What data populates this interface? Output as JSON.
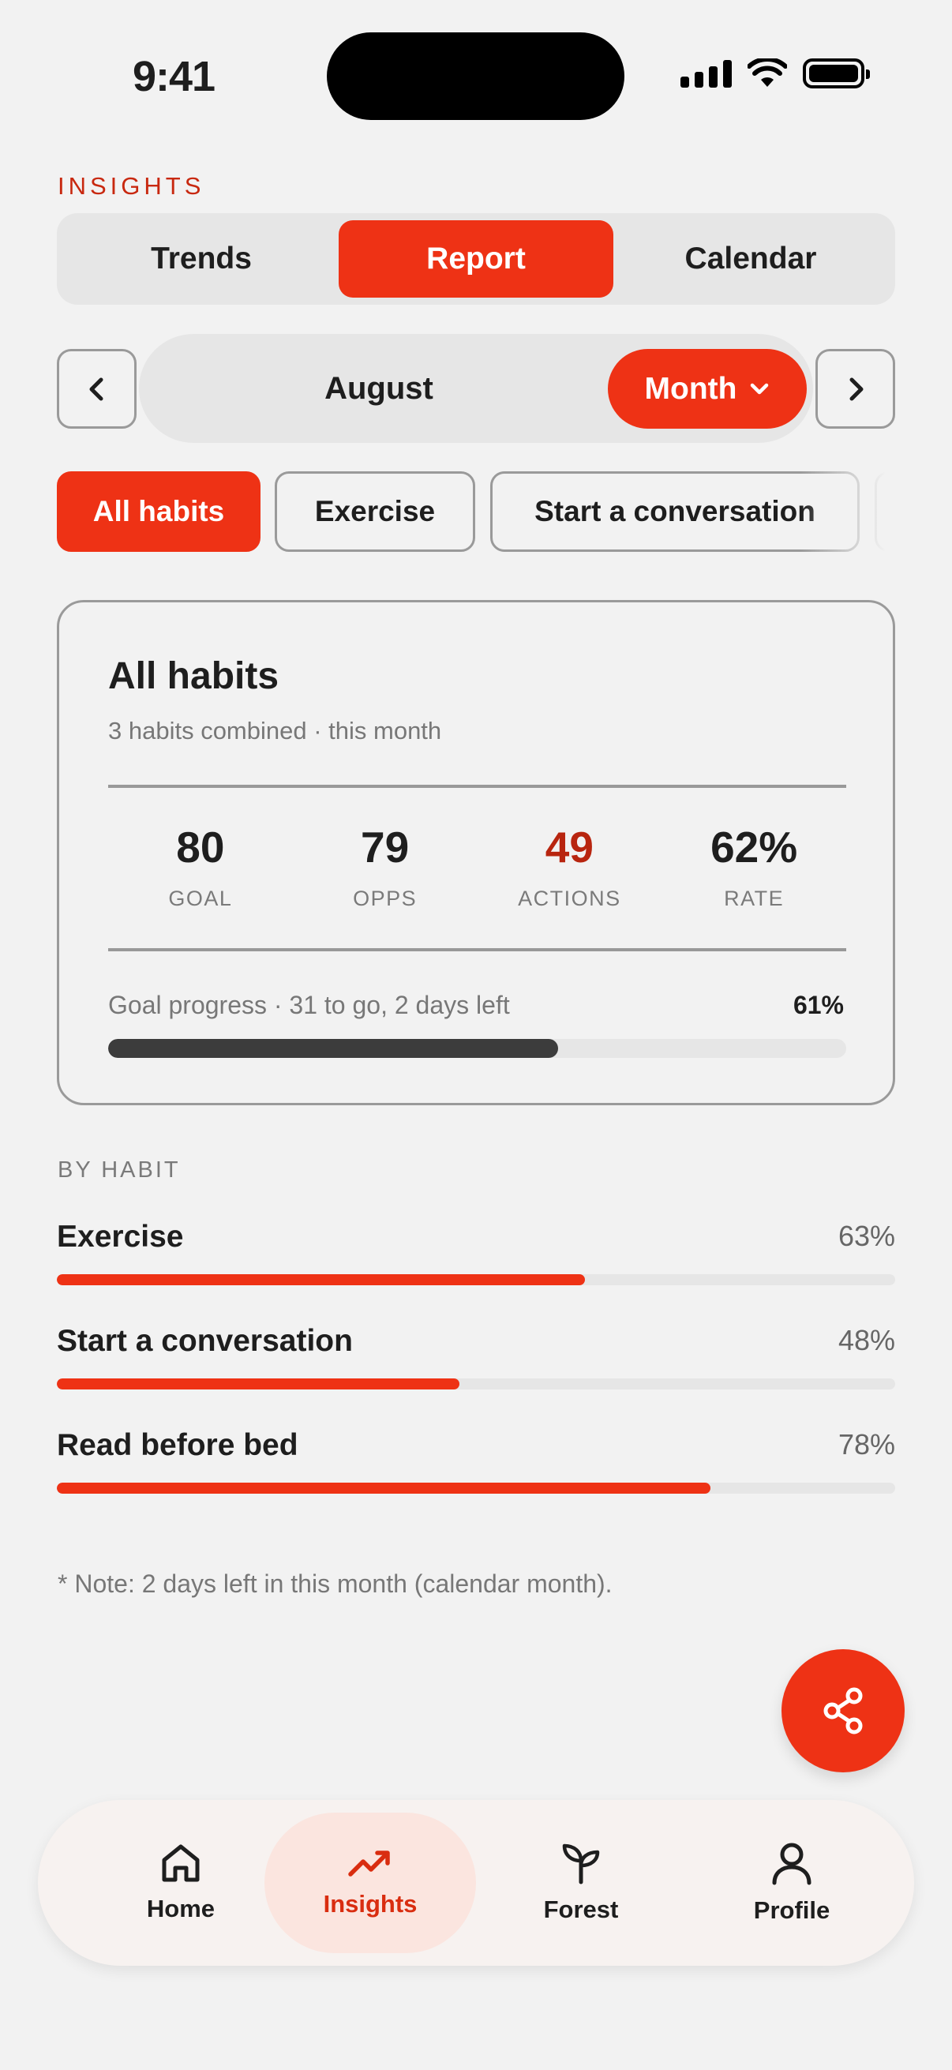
{
  "status_bar": {
    "time": "9:41"
  },
  "section_label": "INSIGHTS",
  "view_tabs": [
    {
      "label": "Trends",
      "active": false
    },
    {
      "label": "Report",
      "active": true
    },
    {
      "label": "Calendar",
      "active": false
    }
  ],
  "period": {
    "label": "August",
    "mode": "Month",
    "prev_icon": "chevron-left-icon",
    "next_icon": "chevron-right-icon"
  },
  "filter_chips": [
    {
      "label": "All habits",
      "active": true
    },
    {
      "label": "Exercise",
      "active": false
    },
    {
      "label": "Start a conversation",
      "active": false
    },
    {
      "label": "",
      "active": false
    }
  ],
  "summary": {
    "title": "All habits",
    "subtitle": "3 habits combined · this month",
    "stats": [
      {
        "value": "80",
        "label": "GOAL"
      },
      {
        "value": "79",
        "label": "OPPS"
      },
      {
        "value": "49",
        "label": "ACTIONS"
      },
      {
        "value": "62%",
        "label": "RATE"
      }
    ],
    "progress_text": "Goal progress · 31 to go, 2 days left",
    "progress_percent_label": "61%",
    "progress_value": 0.61
  },
  "by_habit": {
    "label": "BY HABIT",
    "items": [
      {
        "name": "Exercise",
        "percent_label": "63%",
        "value": 0.63
      },
      {
        "name": "Start a conversation",
        "percent_label": "48%",
        "value": 0.48
      },
      {
        "name": "Read before bed",
        "percent_label": "78%",
        "value": 0.78
      }
    ]
  },
  "note": "* Note: 2 days left in this month (calendar month).",
  "fab_icon": "share-icon",
  "tab_bar": [
    {
      "label": "Home",
      "icon": "home-icon",
      "active": false
    },
    {
      "label": "Insights",
      "icon": "trending-up-icon",
      "active": true
    },
    {
      "label": "Forest",
      "icon": "sprout-icon",
      "active": false
    },
    {
      "label": "Profile",
      "icon": "user-icon",
      "active": false
    }
  ],
  "colors": {
    "accent": "#ee3215",
    "accent_dark": "#b8250f",
    "background": "#f2f2f2",
    "progress_dark": "#3c3c3c"
  }
}
